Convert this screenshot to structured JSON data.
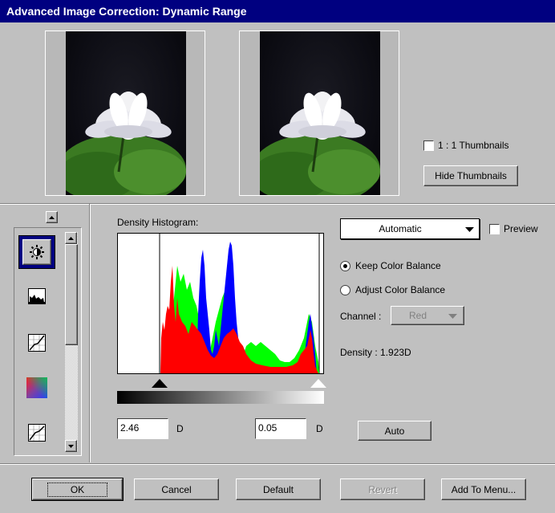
{
  "window": {
    "title": "Advanced Image Correction: Dynamic Range"
  },
  "thumbnails": {
    "one_to_one_label": "1 : 1 Thumbnails",
    "one_to_one_checked": false,
    "hide_button": "Hide Thumbnails"
  },
  "tools": {
    "items": [
      "brightness-icon",
      "histogram-icon",
      "tone-curve-icon",
      "color-gradient-icon",
      "tone-curve-icon"
    ],
    "selected_index": 0
  },
  "histogram": {
    "label": "Density Histogram:",
    "shadow_value": "2.46",
    "highlight_value": "0.05",
    "unit": "D"
  },
  "controls": {
    "mode_value": "Automatic",
    "preview_label": "Preview",
    "preview_checked": false,
    "keep_balance_label": "Keep Color Balance",
    "adjust_balance_label": "Adjust Color Balance",
    "selected_balance": "keep",
    "channel_label": "Channel :",
    "channel_value": "Red",
    "density_text": "Density : 1.923D",
    "auto_button": "Auto"
  },
  "footer": {
    "ok": "OK",
    "cancel": "Cancel",
    "default": "Default",
    "revert": "Revert",
    "add_to_menu": "Add To Menu..."
  },
  "colors": {
    "titlebar": "#000080",
    "red": "#ff0000",
    "green": "#00ff00",
    "blue": "#0000ff"
  }
}
